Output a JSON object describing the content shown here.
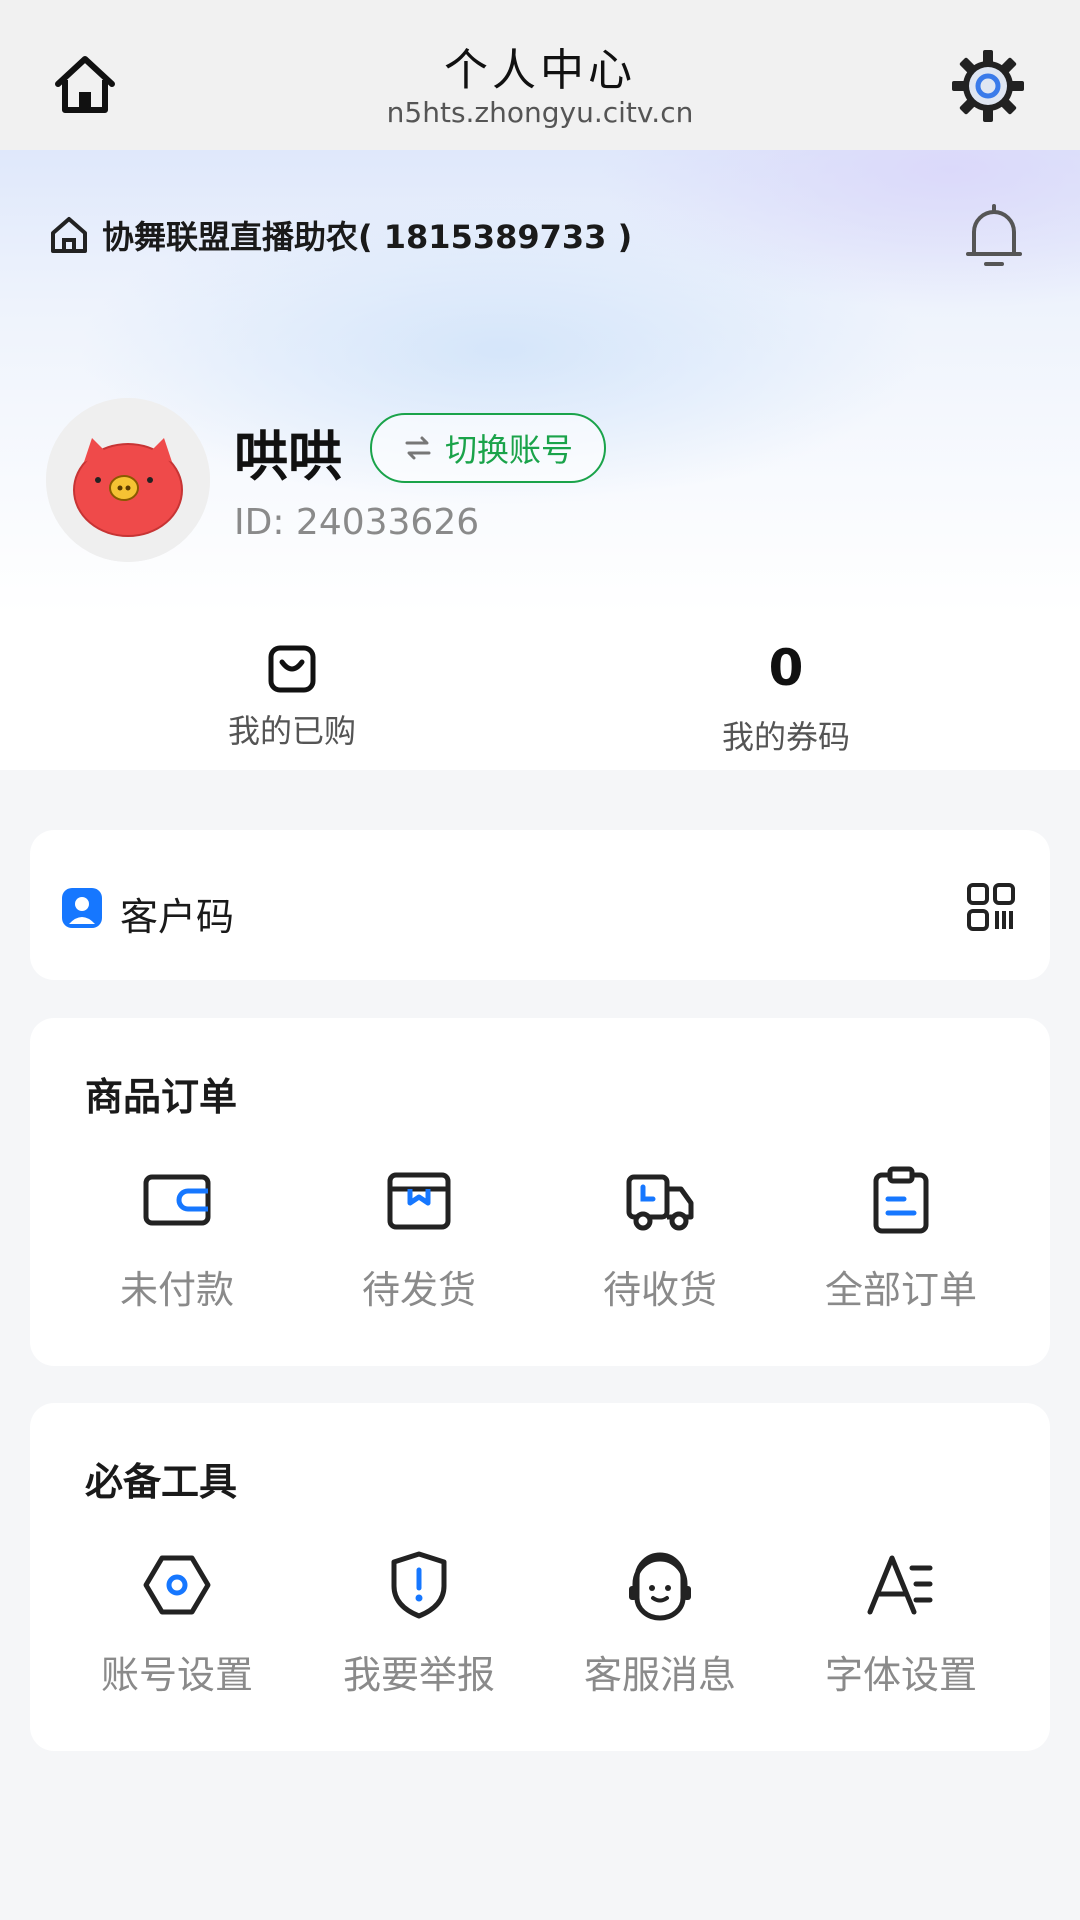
{
  "topbar": {
    "title": "个人中心",
    "url": "n5hts.zhongyu.citv.cn",
    "icons": {
      "home": "home-icon",
      "settings": "gear-icon"
    }
  },
  "header": {
    "org_name": "协舞联盟直播助农( 1815389733 )",
    "icons": {
      "org": "home-outline-icon",
      "bell": "bell-icon"
    }
  },
  "profile": {
    "username": "哄哄",
    "switch_label": "切换账号",
    "user_id": "ID: 24033626"
  },
  "stats": {
    "purchased_label": "我的已购",
    "coupon_count": "0",
    "coupon_label": "我的券码"
  },
  "customer_code": {
    "label": "客户码"
  },
  "orders": {
    "title": "商品订单",
    "items": [
      {
        "label": "未付款",
        "icon": "wallet-icon"
      },
      {
        "label": "待发货",
        "icon": "box-icon"
      },
      {
        "label": "待收货",
        "icon": "truck-icon"
      },
      {
        "label": "全部订单",
        "icon": "clipboard-icon"
      }
    ]
  },
  "tools": {
    "title": "必备工具",
    "items": [
      {
        "label": "账号设置",
        "icon": "hexagon-settings-icon"
      },
      {
        "label": "我要举报",
        "icon": "shield-alert-icon"
      },
      {
        "label": "客服消息",
        "icon": "headset-icon"
      },
      {
        "label": "字体设置",
        "icon": "font-size-icon"
      }
    ]
  },
  "colors": {
    "accent_green": "#1aa34a",
    "accent_blue": "#1677ff",
    "avatar_red": "#ef4a4a"
  }
}
